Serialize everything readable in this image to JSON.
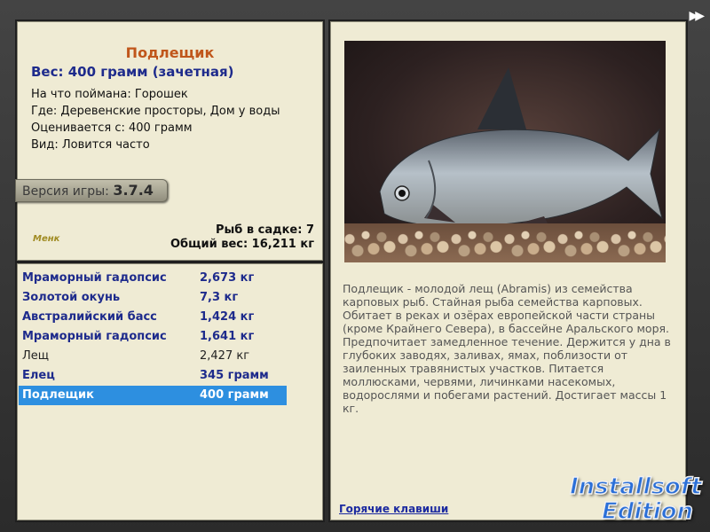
{
  "info": {
    "fish_name": "Подлещик",
    "weight_line": "Вес: 400 грамм (зачетная)",
    "details": [
      "На что поймана: Горошек",
      "Где: Деревенские просторы, Дом у воды",
      "Оценивается с: 400 грамм",
      "Вид: Ловится часто"
    ],
    "version_label": "Версия игры:",
    "version_value": "3.7.4",
    "logo_text": "Менк",
    "cage_count": "Рыб в садке: 7",
    "total_weight": "Общий вес: 16,211 кг"
  },
  "catch_list": [
    {
      "name": "Мраморный гадопсис",
      "weight": "2,673 кг",
      "style": "bold"
    },
    {
      "name": "Золотой окунь",
      "weight": "7,3 кг",
      "style": "bold"
    },
    {
      "name": "Австралийский басс",
      "weight": "1,424 кг",
      "style": "bold"
    },
    {
      "name": "Мраморный гадопсис",
      "weight": "1,641 кг",
      "style": "bold"
    },
    {
      "name": "Лещ",
      "weight": "2,427 кг",
      "style": "plain"
    },
    {
      "name": "Елец",
      "weight": "345 грамм",
      "style": "bold"
    },
    {
      "name": "Подлещик",
      "weight": "400 грамм",
      "style": "selected"
    }
  ],
  "description": "Подлещик - молодой лещ (Abramis) из семейства карповых рыб. Стайная рыба семейства карповых. Обитает в реках и озёрах европейской части страны (кроме Крайнего Севера), в бассейне Аральского моря. Предпочитает замедленное течение. Держится у дна в глубоких заводях, заливах, ямах, поблизости от заиленных травянистых участков. Питается моллюсками, червями, личинками насекомых, водорослями и побегами растений. Достигает массы 1 кг.",
  "hotkeys_label": "Горячие клавиши",
  "fast_forward_icon": "fast-forward-icon",
  "watermark": {
    "line1": "Installsoft",
    "line2": "Edition"
  }
}
